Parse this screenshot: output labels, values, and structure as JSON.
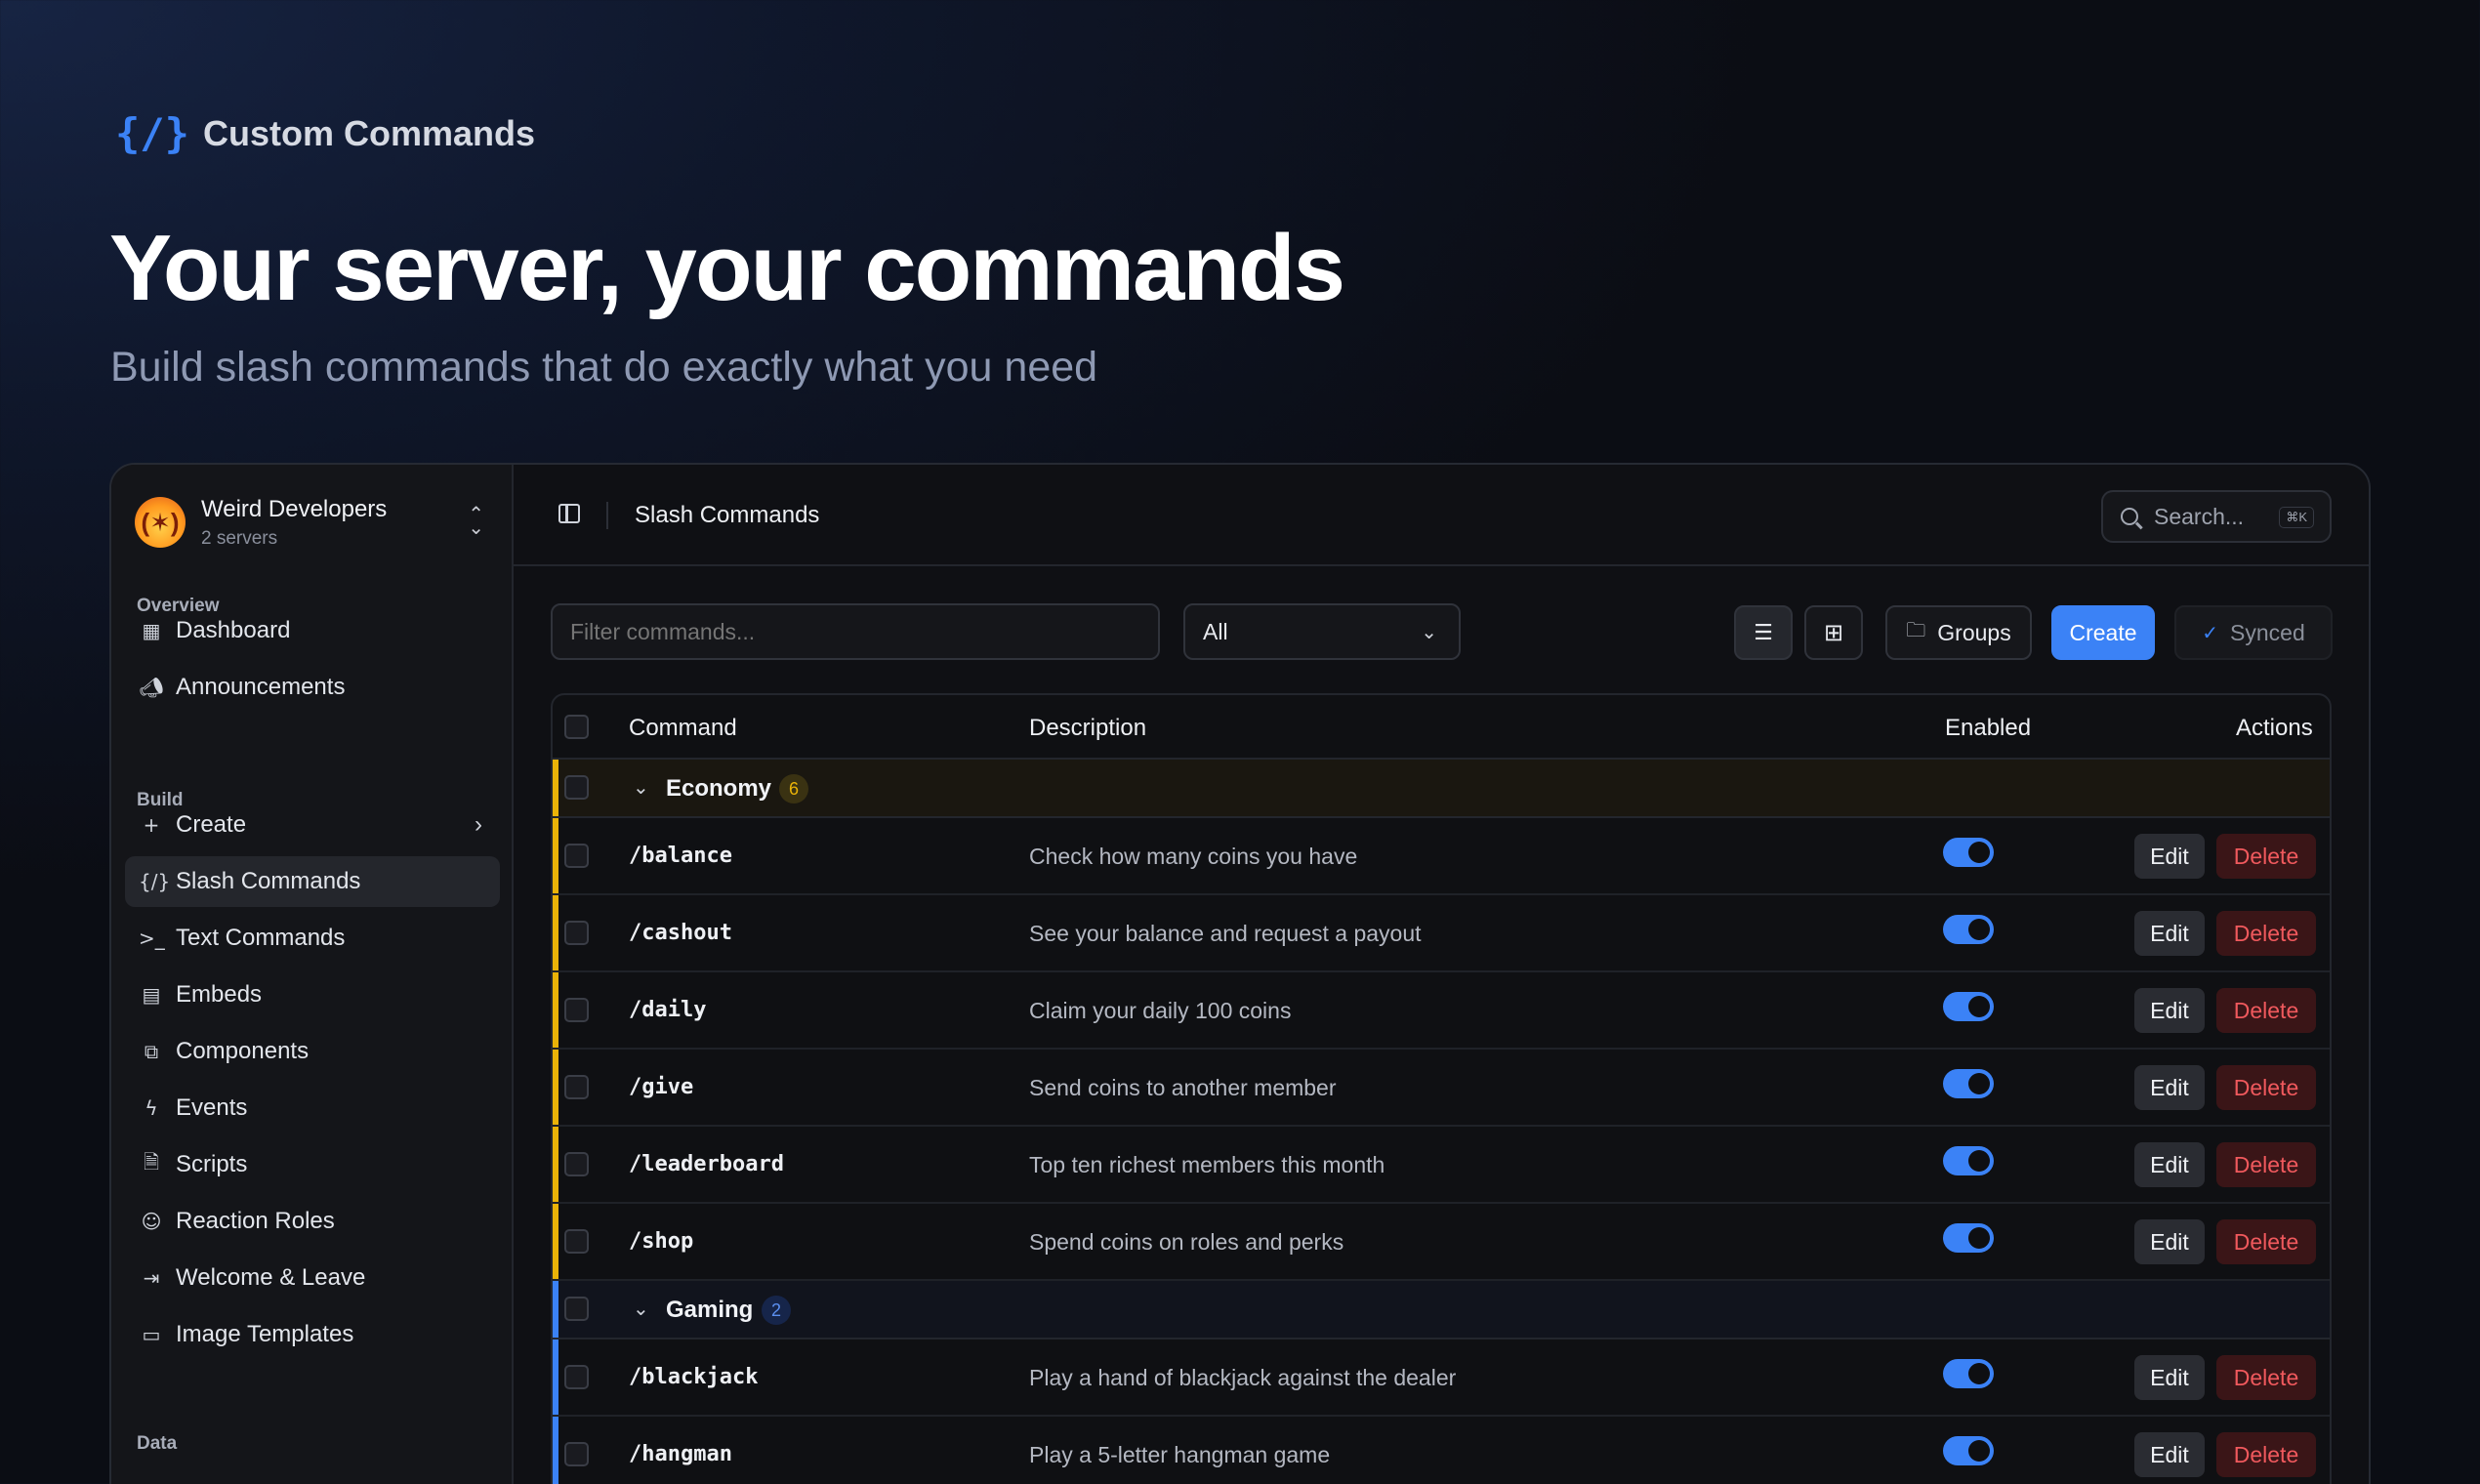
{
  "hero": {
    "brand_icon": "{/}",
    "brand_name": "Custom Commands",
    "title": "Your server, your commands",
    "subtitle": "Build slash commands that do exactly what you need"
  },
  "server": {
    "name": "Weird Developers",
    "count": "2 servers",
    "avatar_icon": "fire-icon"
  },
  "sidebar": {
    "sections": {
      "overview": "Overview",
      "build": "Build",
      "data": "Data"
    },
    "overview_items": [
      {
        "label": "Dashboard",
        "icon": "dashboard-icon"
      },
      {
        "label": "Announcements",
        "icon": "megaphone-icon"
      }
    ],
    "build_items": [
      {
        "label": "Create",
        "icon": "plus-icon"
      },
      {
        "label": "Slash Commands",
        "icon": "slash-icon"
      },
      {
        "label": "Text Commands",
        "icon": "terminal-icon"
      },
      {
        "label": "Embeds",
        "icon": "embed-icon"
      },
      {
        "label": "Components",
        "icon": "components-icon"
      },
      {
        "label": "Events",
        "icon": "bolt-icon"
      },
      {
        "label": "Scripts",
        "icon": "file-icon"
      },
      {
        "label": "Reaction Roles",
        "icon": "smile-icon"
      },
      {
        "label": "Welcome & Leave",
        "icon": "enter-icon"
      },
      {
        "label": "Image Templates",
        "icon": "image-icon"
      }
    ]
  },
  "topbar": {
    "title": "Slash Commands",
    "search_placeholder": "Search...",
    "search_shortcut": "⌘K"
  },
  "toolbar": {
    "filter_placeholder": "Filter commands...",
    "select_value": "All",
    "groups_label": "Groups",
    "create_label": "Create",
    "synced_label": "Synced"
  },
  "table": {
    "columns": {
      "command": "Command",
      "description": "Description",
      "enabled": "Enabled",
      "actions": "Actions"
    },
    "edit_label": "Edit",
    "delete_label": "Delete",
    "groups": [
      {
        "name": "Economy",
        "count": "6",
        "color": "#eab308",
        "commands": [
          {
            "name": "/balance",
            "description": "Check how many coins you have",
            "enabled": true
          },
          {
            "name": "/cashout",
            "description": "See your balance and request a payout",
            "enabled": true
          },
          {
            "name": "/daily",
            "description": "Claim your daily 100 coins",
            "enabled": true
          },
          {
            "name": "/give",
            "description": "Send coins to another member",
            "enabled": true
          },
          {
            "name": "/leaderboard",
            "description": "Top ten richest members this month",
            "enabled": true
          },
          {
            "name": "/shop",
            "description": "Spend coins on roles and perks",
            "enabled": true
          }
        ]
      },
      {
        "name": "Gaming",
        "count": "2",
        "color": "#3b82f6",
        "commands": [
          {
            "name": "/blackjack",
            "description": "Play a hand of blackjack against the dealer",
            "enabled": true
          },
          {
            "name": "/hangman",
            "description": "Play a 5-letter hangman game",
            "enabled": true
          }
        ]
      }
    ]
  },
  "colors": {
    "accent": "#3b82f6",
    "danger": "#f0595d",
    "economy": "#eab308",
    "gaming": "#3b82f6"
  }
}
